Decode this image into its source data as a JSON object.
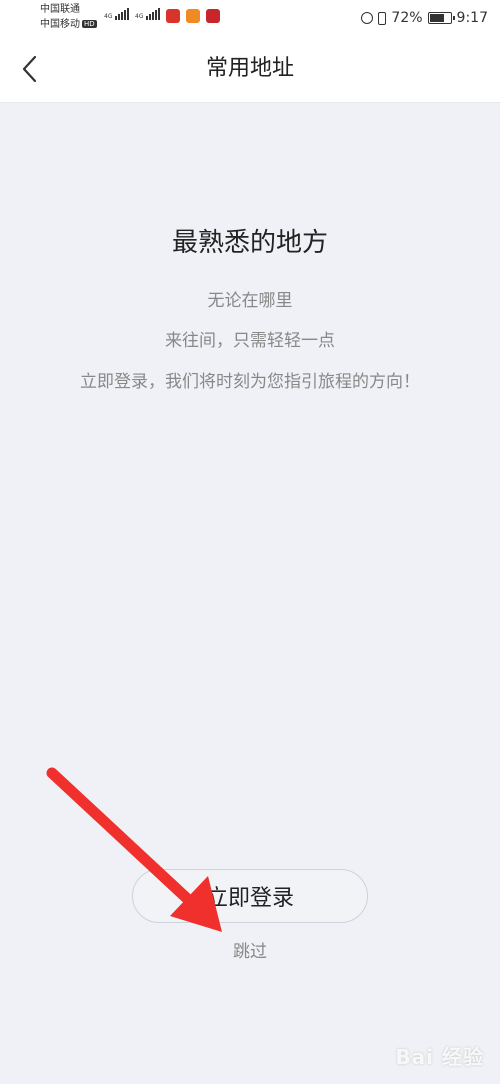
{
  "status_bar": {
    "carrier_1": "中国联通",
    "carrier_2": "中国移动",
    "hd_badge": "HD",
    "network_1": "4G",
    "network_2": "4G",
    "battery": "72%",
    "battery_level": 0.72,
    "time": "9:17"
  },
  "header": {
    "back_icon": "chevron-left-icon",
    "title": "常用地址"
  },
  "main": {
    "headline": "最熟悉的地方",
    "description": [
      "无论在哪里",
      "来往间，只需轻轻一点",
      "立即登录，我们将时刻为您指引旅程的方向！"
    ],
    "login_label": "立即登录",
    "skip_label": "跳过"
  },
  "watermark": "Bai 经验",
  "colors": {
    "background": "#eff1f6",
    "header_background": "#ffffff",
    "annotation_arrow": "#f0302c",
    "secondary_text": "#888888"
  }
}
